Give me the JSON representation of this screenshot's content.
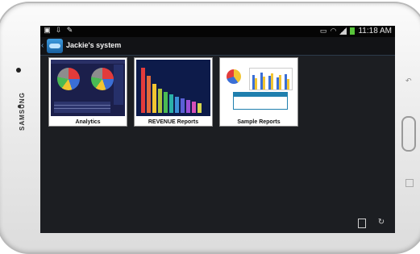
{
  "device": {
    "brand": "SAMSUNG"
  },
  "statusbar": {
    "time": "11:18 AM"
  },
  "actionbar": {
    "title": "Jackie's system"
  },
  "tiles": [
    {
      "label": "Analytics"
    },
    {
      "label": "REVENUE Reports"
    },
    {
      "label": "Sample Reports"
    }
  ],
  "colors": {
    "accent": "#3d9be0",
    "screen_bg": "#1c1e22",
    "battery": "#58c43a"
  }
}
